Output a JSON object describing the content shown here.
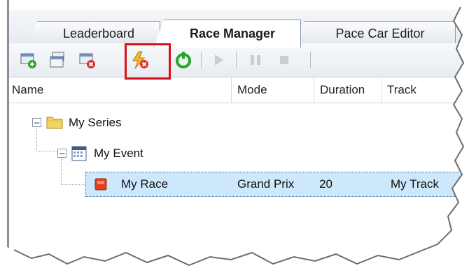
{
  "tabs": [
    {
      "label": "Leaderboard",
      "active": false
    },
    {
      "label": "Race Manager",
      "active": true
    },
    {
      "label": "Pace Car Editor",
      "active": false
    }
  ],
  "toolbar": {
    "buttons": [
      "new-series-icon",
      "new-event-icon",
      "delete-event-icon",
      "delete-race-icon",
      "reset-icon",
      "play-icon",
      "pause-icon",
      "stop-icon"
    ],
    "highlight_color": "#d90f1a"
  },
  "columns": {
    "name": "Name",
    "mode": "Mode",
    "duration": "Duration",
    "track": "Track"
  },
  "tree": {
    "series": {
      "label": "My Series",
      "expander": "−"
    },
    "event": {
      "label": "My Event",
      "expander": "−"
    },
    "race": {
      "label": "My Race",
      "mode": "Grand Prix",
      "duration": "20",
      "track": "My Track"
    }
  },
  "colors": {
    "selection": "#cde8fb",
    "race_icon": "#e2401d",
    "folder": "#f3d462",
    "accent_green": "#2aa52a"
  }
}
